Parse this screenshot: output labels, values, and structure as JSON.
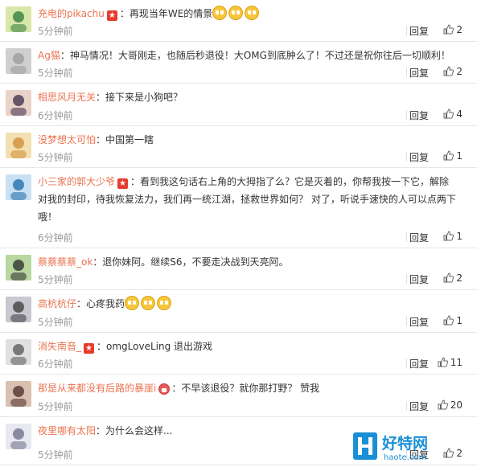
{
  "comments": [
    {
      "user": "充电的pikachu",
      "star": true,
      "content": "：再现当年WE的情景",
      "emojis": 3,
      "time": "5分钟前",
      "reply": "回复",
      "likes": "2"
    },
    {
      "user": "Ag猫",
      "star": false,
      "content": "：神马情况！大哥刚走，也随后秒退役！大OMG到底肿么了！不过还是祝你往后一切顺利！",
      "emojis": 0,
      "time": "5分钟前",
      "reply": "回复",
      "likes": "2"
    },
    {
      "user": "相思风月无关",
      "star": false,
      "content": "：接下来是小狗吧？",
      "emojis": 0,
      "time": "6分钟前",
      "reply": "回复",
      "likes": "4"
    },
    {
      "user": "没梦想太可怕",
      "star": false,
      "content": "：中国第一瞎",
      "emojis": 0,
      "time": "5分钟前",
      "reply": "回复",
      "likes": "1"
    },
    {
      "user": "小三家的郭大少爷",
      "star": true,
      "content": "：看到我这句话右上角的大拇指了么？它是灭着的，你帮我按一下它，解除对我的封印，待我恢复法力，我们再一统江湖，拯救世界如何？ 对了，听说手速快的人可以点两下哦！",
      "emojis": 0,
      "time": "6分钟前",
      "reply": "回复",
      "likes": "1"
    },
    {
      "user": "蔡蔡蔡蔡_ok",
      "star": false,
      "content": "：退你妹阿。继续S6，不要走决战到天亮阿。",
      "emojis": 0,
      "time": "5分钟前",
      "reply": "回复",
      "likes": "2"
    },
    {
      "user": "高杭杭仔",
      "star": false,
      "content": "：心疼我药",
      "emojis": 3,
      "time": "5分钟前",
      "reply": "回复",
      "likes": "1"
    },
    {
      "user": "消失南音_",
      "star": true,
      "content": "：omgLoveLing 退出游戏",
      "emojis": 0,
      "time": "6分钟前",
      "reply": "回复",
      "likes": "11"
    },
    {
      "user": "那是从来都没有后路的暴崖i",
      "star": false,
      "badge": true,
      "content": "：不早该退役？就你那打野？ 赞我",
      "emojis": 0,
      "time": "5分钟前",
      "reply": "回复",
      "likes": "20"
    },
    {
      "user": "夜里哪有太阳",
      "star": false,
      "content": "：为什么会这样...",
      "emojis": 0,
      "time": "5分钟前",
      "reply": "回复",
      "likes": "2"
    }
  ],
  "colors": {
    "username": "#eb7350",
    "time": "#999999",
    "divider": "#e6e6e6",
    "star": "#e73b2b"
  },
  "watermark": {
    "brand": "好特网",
    "domain": "haote.com"
  }
}
